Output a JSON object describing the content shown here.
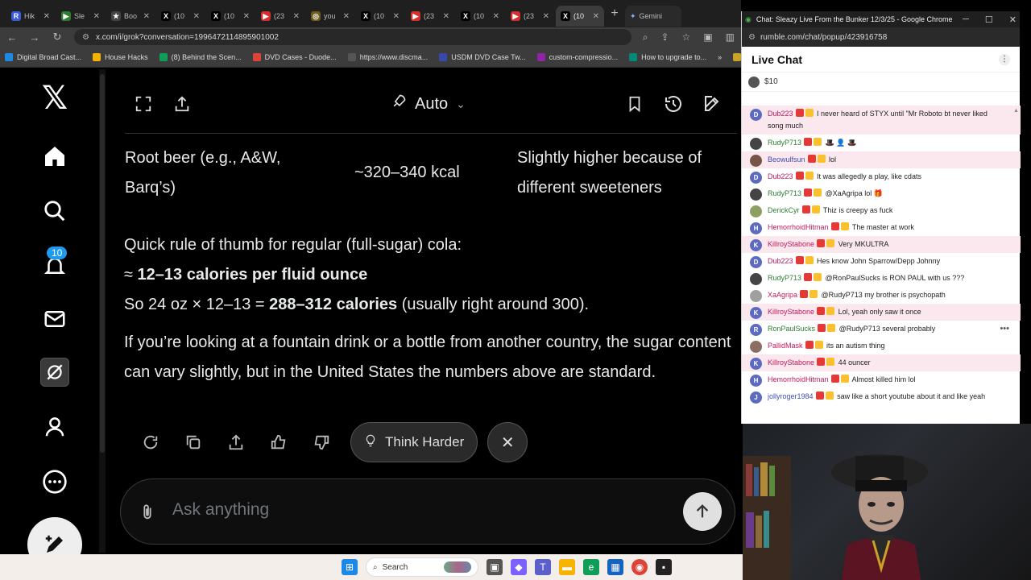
{
  "browser": {
    "tabs": [
      {
        "label": "Hik",
        "color": "#3b5bdb",
        "glyph": "R"
      },
      {
        "label": "Sle",
        "color": "#2e7d32",
        "glyph": "▶"
      },
      {
        "label": "Boo",
        "color": "#444444",
        "glyph": "★"
      },
      {
        "label": "(10",
        "color": "#000000",
        "glyph": "X"
      },
      {
        "label": "(10",
        "color": "#000000",
        "glyph": "X"
      },
      {
        "label": "(23",
        "color": "#d32f2f",
        "glyph": "▶"
      },
      {
        "label": "you",
        "color": "#6d5b1f",
        "glyph": "◎"
      },
      {
        "label": "(10",
        "color": "#000000",
        "glyph": "X"
      },
      {
        "label": "(23",
        "color": "#d32f2f",
        "glyph": "▶"
      },
      {
        "label": "(10",
        "color": "#000000",
        "glyph": "X"
      },
      {
        "label": "(23",
        "color": "#d32f2f",
        "glyph": "▶"
      },
      {
        "label": "(10",
        "color": "#000000",
        "glyph": "X"
      }
    ],
    "gemini_tab": "Gemini",
    "url": "x.com/i/grok?conversation=1996472114895901002",
    "bookmarks": [
      "Digital Broad Cast...",
      "House Hacks",
      "(8) Behind the Scen...",
      "DVD Cases - Duode...",
      "https://www.discma...",
      "USDM DVD Case Tw...",
      "custom-compressio...",
      "How to upgrade to..."
    ],
    "all_bookmarks": "All Bo"
  },
  "x_nav": {
    "notifications_count": "10"
  },
  "grok": {
    "mode_label": "Auto",
    "table_row": {
      "item": "Root beer (e.g., A&W, Barq’s)",
      "calories": "~320–340 kcal",
      "note": "Slightly higher because of different sweeteners"
    },
    "answer": {
      "rule_intro": "Quick rule of thumb for regular (full-sugar) cola:",
      "rule_prefix": "≈ ",
      "rule_bold": "12–13 calories per fluid ounce",
      "calc_prefix": "So 24 oz × 12–13 = ",
      "calc_bold": "288–312 calories",
      "calc_suffix": " (usually right around 300).",
      "closing": "If you’re looking at a fountain drink or a bottle from another country, the sugar content can vary slightly, but in the United States the numbers above are standard."
    },
    "think_harder_label": "Think Harder",
    "ask_placeholder": "Ask anything"
  },
  "taskbar": {
    "search_label": "Search"
  },
  "chat": {
    "window_title": "Chat: Sleazy Live From the Bunker 12/3/25 - Google Chrome",
    "url": "rumble.com/chat/popup/423916758",
    "heading": "Live Chat",
    "pinned_amount": "$10",
    "messages": [
      {
        "user": "Dub223",
        "color": "#c2185b",
        "avatar": "D",
        "avbg": "#5c6bc0",
        "text": "I never heard of STYX until \"Mr Roboto bt never liked song much",
        "hl": true
      },
      {
        "user": "RudyP713",
        "color": "#2e7d32",
        "avatar": "",
        "avbg": "#444444",
        "text": "🎩 👤 🎩",
        "hl": false
      },
      {
        "user": "Beowulfsun",
        "color": "#3f51b5",
        "avatar": "",
        "avbg": "#795548",
        "text": "lol",
        "hl": true
      },
      {
        "user": "Dub223",
        "color": "#c2185b",
        "avatar": "D",
        "avbg": "#5c6bc0",
        "text": "It was allegedly a play, like cdats",
        "hl": false
      },
      {
        "user": "RudyP713",
        "color": "#2e7d32",
        "avatar": "",
        "avbg": "#444444",
        "text": "@XaAgripa lol 🎁",
        "hl": false
      },
      {
        "user": "DerickCyr",
        "color": "#2e7d32",
        "avatar": "",
        "avbg": "#8d9f62",
        "text": "Thiz is creepy as fuck",
        "hl": false
      },
      {
        "user": "HemorrhoidHitman",
        "color": "#c2185b",
        "avatar": "H",
        "avbg": "#5c6bc0",
        "text": "The master at work",
        "hl": false
      },
      {
        "user": "KillroyStabone",
        "color": "#c2185b",
        "avatar": "K",
        "avbg": "#5c6bc0",
        "text": "Very MKULTRA",
        "hl": true
      },
      {
        "user": "Dub223",
        "color": "#c2185b",
        "avatar": "D",
        "avbg": "#5c6bc0",
        "text": "Hes know John Sparrow/Depp Johnny",
        "hl": false
      },
      {
        "user": "RudyP713",
        "color": "#2e7d32",
        "avatar": "",
        "avbg": "#444444",
        "text": "@RonPaulSucks is RON PAUL with us ???",
        "hl": false
      },
      {
        "user": "XaAgripa",
        "color": "#c2185b",
        "avatar": "",
        "avbg": "#a0a0a0",
        "text": "@RudyP713 my brother is psychopath",
        "hl": false
      },
      {
        "user": "KillroyStabone",
        "color": "#c2185b",
        "avatar": "K",
        "avbg": "#5c6bc0",
        "text": "Lol, yeah only saw it once",
        "hl": true
      },
      {
        "user": "RonPaulSucks",
        "color": "#2e7d32",
        "avatar": "R",
        "avbg": "#5c6bc0",
        "text": "@RudyP713 several probably",
        "hl": false
      },
      {
        "user": "PallidMask",
        "color": "#c2185b",
        "avatar": "",
        "avbg": "#8d6e63",
        "text": "its an autism thing",
        "hl": false
      },
      {
        "user": "KillroyStabone",
        "color": "#c2185b",
        "avatar": "K",
        "avbg": "#5c6bc0",
        "text": "44 ouncer",
        "hl": true
      },
      {
        "user": "HemorrhoidHitman",
        "color": "#c2185b",
        "avatar": "H",
        "avbg": "#5c6bc0",
        "text": "Almost killed him lol",
        "hl": false
      },
      {
        "user": "jollyroger1984",
        "color": "#3f51b5",
        "avatar": "J",
        "avbg": "#5c6bc0",
        "text": "saw like a short youtube about it and like yeah",
        "hl": false
      }
    ]
  }
}
